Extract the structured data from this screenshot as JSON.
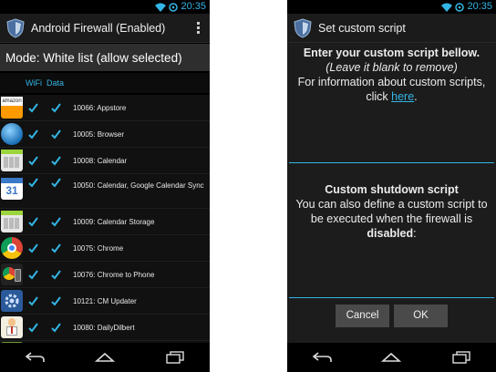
{
  "status": {
    "time": "20:35"
  },
  "firewall": {
    "title": "Android Firewall (Enabled)",
    "mode": "Mode: White list (allow selected)",
    "headers": {
      "wifi": "WiFi",
      "data": "Data"
    },
    "apps": [
      {
        "label": "10066: Appstore",
        "icon": "appstore-icon",
        "wifi": true,
        "data": true
      },
      {
        "label": "10005: Browser",
        "icon": "browser-icon",
        "wifi": true,
        "data": true
      },
      {
        "label": "10008: Calendar",
        "icon": "calendar-icon",
        "wifi": true,
        "data": true
      },
      {
        "label": "10050: Calendar, Google Calendar Sync",
        "icon": "calendar-31-icon",
        "wifi": true,
        "data": true
      },
      {
        "label": "10009: Calendar Storage",
        "icon": "calendar-storage-icon",
        "wifi": true,
        "data": true
      },
      {
        "label": "10075: Chrome",
        "icon": "chrome-icon",
        "wifi": true,
        "data": true
      },
      {
        "label": "10076: Chrome to Phone",
        "icon": "chrome-to-phone-icon",
        "wifi": true,
        "data": true
      },
      {
        "label": "10121: CM Updater",
        "icon": "cm-updater-icon",
        "wifi": true,
        "data": true
      },
      {
        "label": "10080: DailyDilbert",
        "icon": "dailydilbert-icon",
        "wifi": true,
        "data": true
      }
    ]
  },
  "dialog": {
    "title": "Set custom script",
    "line1": "Enter your custom script bellow.",
    "line2": "(Leave it blank to remove)",
    "line3_prefix": "For information about custom scripts, click ",
    "link": "here",
    "line3_suffix": ".",
    "shutdown_heading": "Custom shutdown script",
    "shutdown_prefix": "You can also define a custom script to be executed when the firewall is ",
    "shutdown_bold": "disabled",
    "shutdown_suffix": ":",
    "cancel": "Cancel",
    "ok": "OK"
  },
  "colors": {
    "accent": "#33b5e5",
    "background": "#000000"
  }
}
